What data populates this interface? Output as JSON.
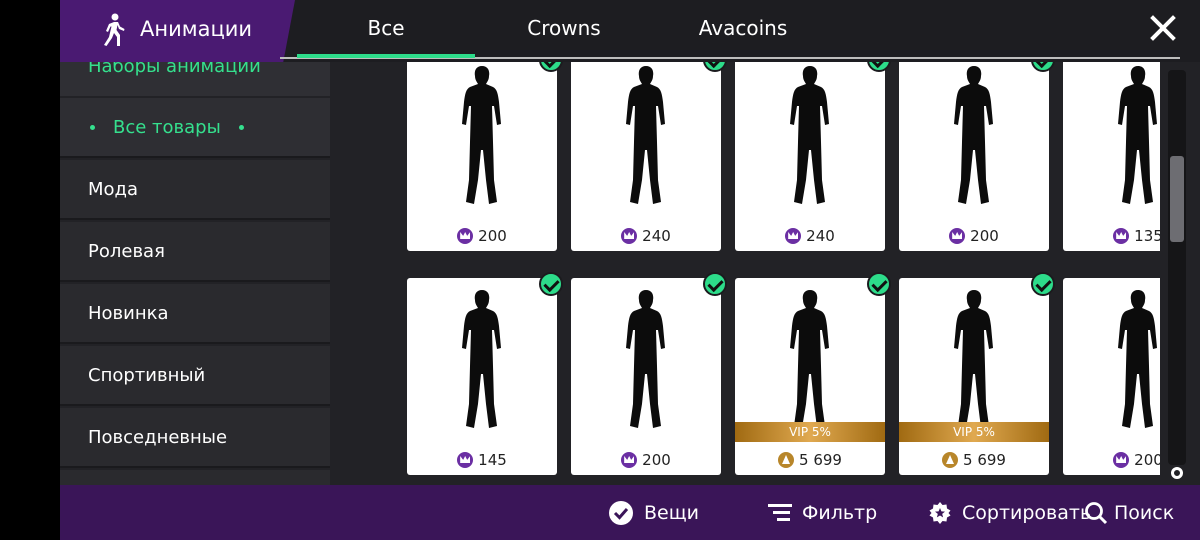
{
  "header": {
    "title": "Анимации",
    "tabs": [
      {
        "label": "Все",
        "active": true
      },
      {
        "label": "Crowns",
        "active": false
      },
      {
        "label": "Avacoins",
        "active": false
      }
    ]
  },
  "sidebar": {
    "partial_item": "Наборы анимации",
    "items": [
      {
        "label": "Все товары",
        "active": true
      },
      {
        "label": "Мода",
        "active": false
      },
      {
        "label": "Ролевая",
        "active": false
      },
      {
        "label": "Новинка",
        "active": false
      },
      {
        "label": "Спортивный",
        "active": false
      },
      {
        "label": "Повседневные",
        "active": false
      }
    ]
  },
  "cards": [
    {
      "price": "200",
      "currency": "crowns",
      "owned": true,
      "vip": ""
    },
    {
      "price": "240",
      "currency": "crowns",
      "owned": true,
      "vip": ""
    },
    {
      "price": "240",
      "currency": "crowns",
      "owned": true,
      "vip": ""
    },
    {
      "price": "200",
      "currency": "crowns",
      "owned": true,
      "vip": ""
    },
    {
      "price": "135",
      "currency": "crowns",
      "owned": true,
      "vip": ""
    },
    {
      "price": "145",
      "currency": "crowns",
      "owned": true,
      "vip": ""
    },
    {
      "price": "200",
      "currency": "crowns",
      "owned": true,
      "vip": ""
    },
    {
      "price": "5 699",
      "currency": "avacoins",
      "owned": true,
      "vip": "VIP 5%"
    },
    {
      "price": "5 699",
      "currency": "avacoins",
      "owned": true,
      "vip": "VIP 5%"
    },
    {
      "price": "200",
      "currency": "crowns",
      "owned": true,
      "vip": ""
    }
  ],
  "bottom_bar": {
    "items_label": "Вещи",
    "filter_label": "Фильтр",
    "sort_label": "Сортировать",
    "search_label": "Поиск"
  },
  "colors": {
    "accent": "#2ddc8a",
    "header_purple": "#4a1a72",
    "bottom_purple": "#3a1558",
    "crown": "#6b2fa3",
    "gold": "#c8902f"
  }
}
